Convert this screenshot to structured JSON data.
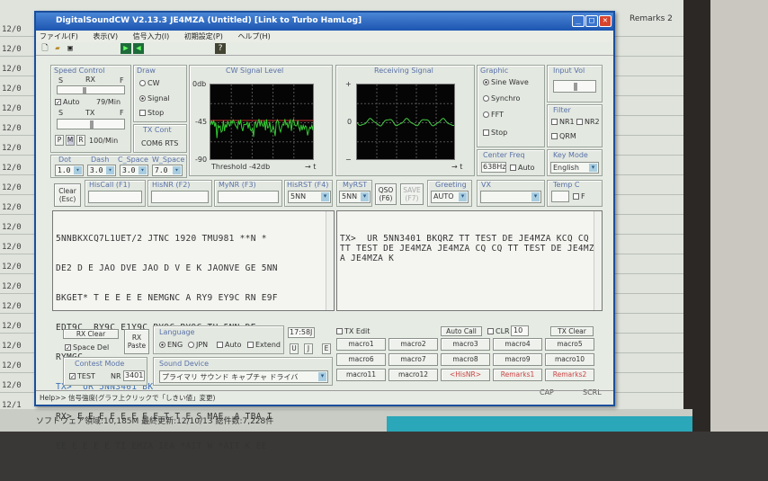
{
  "background": {
    "dates": [
      "12/0",
      "12/0",
      "12/0",
      "12/0",
      "12/0",
      "12/0",
      "12/0",
      "12/0",
      "12/0",
      "12/0",
      "12/0",
      "12/0",
      "12/0",
      "12/0",
      "12/0",
      "12/0",
      "12/0",
      "12/0",
      "12/0",
      "12/1"
    ],
    "remarks_header": "Remarks 2",
    "status_text": "ソフトウェア領域:10,185M   最終更新:12/10/13   総件数:7,228件"
  },
  "window": {
    "title": "DigitalSoundCW V2.13.3 JE4MZA (Untitled) [Link to Turbo HamLog]",
    "menu": [
      "ファイル(F)",
      "表示(V)",
      "信号入力(I)",
      "初期設定(P)",
      "ヘルプ(H)"
    ]
  },
  "speed_control": {
    "label": "Speed Control",
    "rx_label": "RX",
    "tx_label": "TX",
    "slow": "S",
    "fast": "F",
    "auto_label": "Auto",
    "auto_checked": true,
    "rx_speed": "79/Min",
    "tx_speed": "100/Min",
    "mode_buttons": [
      "P",
      "M",
      "R"
    ]
  },
  "draw": {
    "label": "Draw",
    "options": [
      "CW",
      "Signal"
    ],
    "selected": "Signal",
    "stop_label": "Stop"
  },
  "tx_cont": {
    "label": "TX Cont",
    "value": "COM6 RTS"
  },
  "timing": {
    "dot_label": "Dot",
    "dot": "1.0",
    "dash_label": "Dash",
    "dash": "3.0",
    "cspace_label": "C_Space",
    "cspace": "3.0",
    "wspace_label": "W_Space",
    "wspace": "7.0"
  },
  "cw_signal": {
    "label": "CW Signal Level",
    "y_top": "0db",
    "y_mid": "-45",
    "y_bottom": "-90",
    "threshold": "Threshold -42db",
    "x_axis": "→ t"
  },
  "receiving_signal": {
    "label": "Receiving Signal",
    "y_top": "+",
    "y_mid": "0",
    "y_bottom": "−",
    "x_axis": "→ t"
  },
  "graphic": {
    "label": "Graphic",
    "options": [
      "Sine Wave",
      "Synchro",
      "FFT"
    ],
    "selected": "Sine Wave",
    "stop_label": "Stop"
  },
  "input_vol": {
    "label": "Input Vol"
  },
  "filter": {
    "label": "Filter",
    "options": [
      "NR1",
      "NR2",
      "QRM"
    ]
  },
  "center_freq": {
    "label": "Center Freq",
    "value": "638Hz",
    "auto_label": "Auto"
  },
  "key_mode": {
    "label": "Key Mode",
    "value": "English"
  },
  "fields": {
    "clear_label": "Clear\n(Esc)",
    "hiscall_label": "HisCall  (F1)",
    "hiscall_value": "",
    "hisnr_label": "HisNR  (F2)",
    "hisnr_value": "",
    "mynr_label": "MyNR  (F3)",
    "mynr_value": "",
    "hisrst_label": "HisRST (F4)",
    "hisrst_value": "5NN",
    "myrst_label": "MyRST",
    "myrst_value": "5NN",
    "qso_label": "QSO\n(F6)",
    "save_label": "SAVE\n(F7)",
    "greeting_label": "Greeting",
    "greeting_value": "AUTO",
    "vx_label": "VX",
    "vx_value": "",
    "temp_label": "Temp C",
    "temp_f_label": "F"
  },
  "rx_text": {
    "lines": [
      "5NNBKXCQ7L1UET/2 JTNC 1920 TMU981 **N *",
      "DE2 D E JAO DVE JAO D V E K JAONVE GE 5NN",
      "BKGET* T E E E E NEMGNC A RY9 EY9C RN E9F",
      "EDT9C  RY9C E1Y9C RY9C RY9C TU 5NN DE",
      "RYMGC"
    ],
    "tx_line": "TX>  UR 5NN3401 BK",
    "rx_lines": [
      "RX> E E E E E E E E T T E S MAE  A TBA I",
      "EE E E E E TI EMZA IEA *AIT W *AIT K EE"
    ]
  },
  "tx_text": "TX>  UR 5NN3401 BKQRZ TT TEST DE JE4MZA KCQ CQ TT TEST DE JE4MZA JE4MZA CQ CQ TT TEST DE JE4MZA JE4MZA K",
  "bottom": {
    "rx_clear": "RX Clear",
    "space_del": "Space Del",
    "rx_paste": "RX\nPaste",
    "language_label": "Language",
    "lang_options": [
      "ENG",
      "JPN"
    ],
    "lang_selected": "ENG",
    "auto_label": "Auto",
    "extend_label": "Extend",
    "time": "17:58J",
    "ujE": [
      "U",
      "J",
      "E"
    ],
    "contest_label": "Contest Mode",
    "test_label": "TEST",
    "nr_label": "NR",
    "nr_value": "3401",
    "sound_label": "Sound Device",
    "sound_value": "プライマリ サウンド キャプチャ ドライバ",
    "tx_edit": "TX Edit",
    "auto_call": "Auto Call",
    "clr": "CLR",
    "clr_value": "10",
    "tx_clear": "TX Clear",
    "macros": [
      "macro1",
      "macro2",
      "macro3",
      "macro4",
      "macro5",
      "macro6",
      "macro7",
      "macro8",
      "macro9",
      "macro10",
      "macro11",
      "macro12",
      "<HisNR>",
      "Remarks1",
      "Remarks2"
    ],
    "cap": "CAP",
    "scrl": "SCRL"
  },
  "help": "Help>> 信号強度(グラフ上クリックで「しきい値」変更)"
}
